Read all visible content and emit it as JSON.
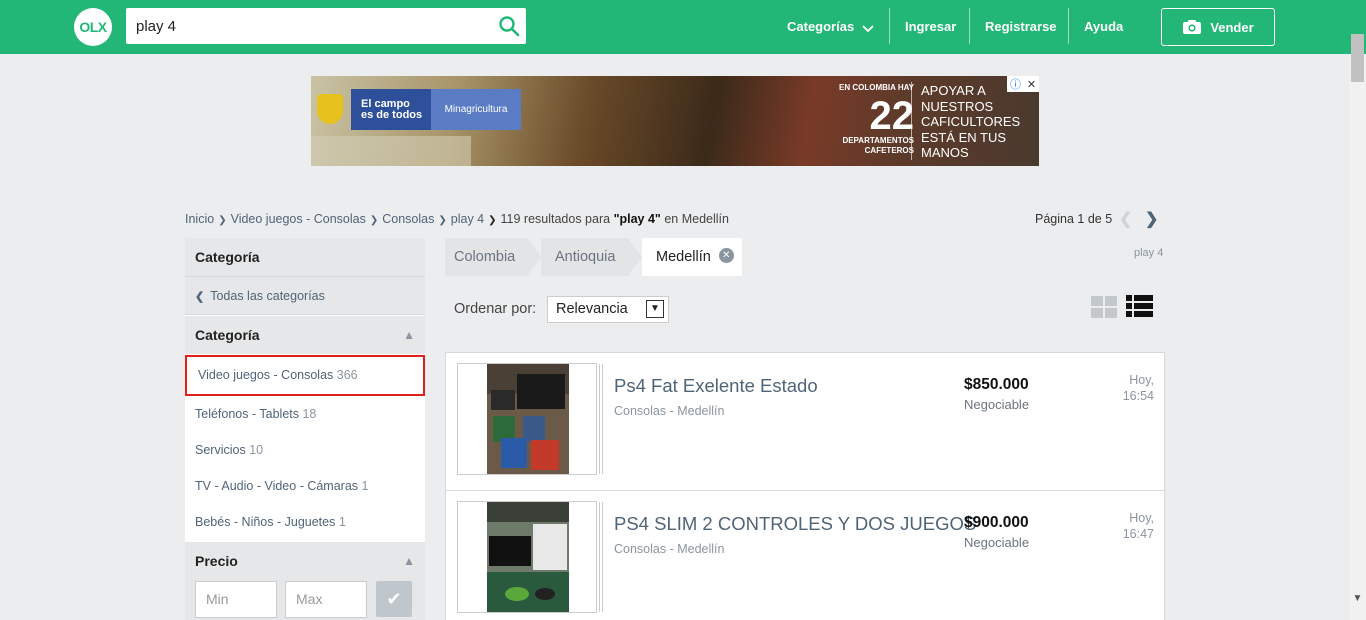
{
  "header": {
    "logo_text": "OLX",
    "search_value": "play 4",
    "nav": {
      "categories": "Categorías",
      "login": "Ingresar",
      "register": "Registrarse",
      "help": "Ayuda"
    },
    "sell_label": "Vender"
  },
  "ad_banner": {
    "gov_line1": "El campo",
    "gov_line2": "es de todos",
    "gov_ministry": "Minagricultura",
    "stat_top": "EN COLOMBIA HAY",
    "stat_number": "22",
    "stat_bottom1": "DEPARTAMENTOS",
    "stat_bottom2": "CAFETEROS",
    "message": "APOYAR A NUESTROS CAFICULTORES ESTÁ EN TUS MANOS"
  },
  "breadcrumb": {
    "items": [
      "Inicio",
      "Video juegos - Consolas",
      "Consolas",
      "play 4"
    ],
    "results_prefix": "119 resultados para ",
    "results_query": "\"play 4\"",
    "results_suffix": " en Medellín"
  },
  "pagination": {
    "label": "Página 1 de 5"
  },
  "sidebar": {
    "category_title": "Categoría",
    "all_categories": "Todas las categorías",
    "category_section_title": "Categoría",
    "categories": [
      {
        "label": "Video juegos - Consolas",
        "count": "366"
      },
      {
        "label": "Teléfonos - Tablets",
        "count": "18"
      },
      {
        "label": "Servicios",
        "count": "10"
      },
      {
        "label": "TV - Audio - Video - Cámaras",
        "count": "1"
      },
      {
        "label": "Bebés - Niños - Juguetes",
        "count": "1"
      }
    ],
    "price_title": "Precio",
    "price_min_placeholder": "Min",
    "price_max_placeholder": "Max"
  },
  "location": {
    "tabs": [
      "Colombia",
      "Antioquia",
      "Medellín"
    ],
    "query_tag": "play 4"
  },
  "sort": {
    "label": "Ordenar por:",
    "selected": "Relevancia"
  },
  "listings": [
    {
      "title": "Ps4 Fat Exelente Estado",
      "location": "Consolas - Medellín",
      "price": "$850.000",
      "price_note": "Negociable",
      "date_line1": "Hoy,",
      "date_line2": "16:54"
    },
    {
      "title": "PS4 SLIM 2 CONTROLES Y DOS JUEGOS",
      "location": "Consolas - Medellín",
      "price": "$900.000",
      "price_note": "Negociable",
      "date_line1": "Hoy,",
      "date_line2": "16:47"
    }
  ],
  "colors": {
    "brand_green": "#22b776",
    "highlight_red": "#e0201c",
    "link_slate": "#506478"
  }
}
